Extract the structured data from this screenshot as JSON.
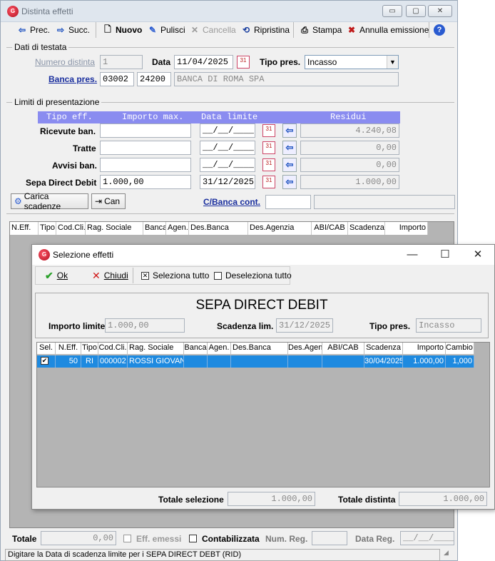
{
  "main_window": {
    "title": "Distinta effetti",
    "caption_buttons": {
      "minimize": "▭",
      "maximize": "▢",
      "close": "✕"
    },
    "toolbar": {
      "prec": "Prec.",
      "succ": "Succ.",
      "nuovo": "Nuovo",
      "pulisci": "Pulisci",
      "cancella": "Cancella",
      "ripristina": "Ripristina",
      "stampa": "Stampa",
      "annulla_emissione": "Annulla emissione"
    },
    "testata": {
      "group_label": "Dati di testata",
      "numero_distinta_label": "Numero distinta",
      "numero_distinta_value": "1",
      "data_label": "Data",
      "data_value": "11/04/2025",
      "tipo_pres_label": "Tipo pres.",
      "tipo_pres_value": "Incasso",
      "banca_pres_label": "Banca pres.",
      "abi": "03002",
      "cab": "24200",
      "banca_name": "BANCA DI ROMA SPA"
    },
    "limiti": {
      "group_label": "Limiti di presentazione",
      "headers": {
        "tipo_eff": "Tipo eff.",
        "importo_max": "Importo max.",
        "data_limite": "Data limite",
        "residui": "Residui"
      },
      "rows": [
        {
          "label": "Ricevute ban.",
          "importo": "",
          "data": "__/__/____",
          "residuo": "4.240,08"
        },
        {
          "label": "Tratte",
          "importo": "",
          "data": "__/__/____",
          "residuo": "0,00"
        },
        {
          "label": "Avvisi ban.",
          "importo": "",
          "data": "__/__/____",
          "residuo": "0,00"
        },
        {
          "label": "Sepa Direct Debit",
          "importo": "1.000,00",
          "data": "31/12/2025",
          "residuo": "1.000,00"
        }
      ],
      "carica_scadenze": "Carica scadenze",
      "can": "Can",
      "c_banca_cont_label": "C/Banca cont."
    },
    "grid_headers": [
      "N.Eff.",
      "Tipo",
      "Cod.Cli.",
      "Rag. Sociale",
      "Banca",
      "Agen.",
      "Des.Banca",
      "Des.Agenzia",
      "ABI/CAB",
      "Scadenza",
      "Importo"
    ],
    "footer": {
      "totale_label": "Totale",
      "totale_value": "0,00",
      "eff_emessi": "Eff. emessi",
      "contabilizzata": "Contabilizzata",
      "num_reg_label": "Num. Reg.",
      "data_reg_label": "Data Reg.",
      "data_reg_value": "__/__/____"
    },
    "status_bar": "Digitare la Data di scadenza limite per i SEPA DIRECT DEBT (RID)"
  },
  "dialog": {
    "title": "Selezione effetti",
    "caption_buttons": {
      "minimize": "—",
      "maximize": "☐",
      "close": "✕"
    },
    "toolbar": {
      "ok": "Ok",
      "chiudi": "Chiudi",
      "seleziona_tutto": "Seleziona tutto",
      "deseleziona_tutto": "Deseleziona tutto"
    },
    "heading": "SEPA DIRECT DEBIT",
    "importo_limite_label": "Importo limite",
    "importo_limite_value": "1.000,00",
    "scadenza_lim_label": "Scadenza lim.",
    "scadenza_lim_value": "31/12/2025",
    "tipo_pres_label": "Tipo pres.",
    "tipo_pres_value": "Incasso",
    "grid_headers": [
      "Sel.",
      "N.Eff.",
      "Tipo",
      "Cod.Cli.",
      "Rag. Sociale",
      "Banca",
      "Agen.",
      "Des.Banca",
      "Des.Agen.",
      "ABI/CAB",
      "Scadenza",
      "Importo",
      "Cambio"
    ],
    "rows": [
      {
        "sel": true,
        "n_eff": "50",
        "tipo": "RI",
        "cod_cli": "000002",
        "rag_sociale": "ROSSI GIOVANN",
        "banca": "",
        "agen": "",
        "des_banca": "",
        "des_agen": "",
        "abi_cab": "",
        "scadenza": "30/04/2025",
        "importo": "1.000,00",
        "cambio": "1,000"
      }
    ],
    "totale_selezione_label": "Totale selezione",
    "totale_selezione_value": "1.000,00",
    "totale_distinta_label": "Totale distinta",
    "totale_distinta_value": "1.000,00"
  }
}
